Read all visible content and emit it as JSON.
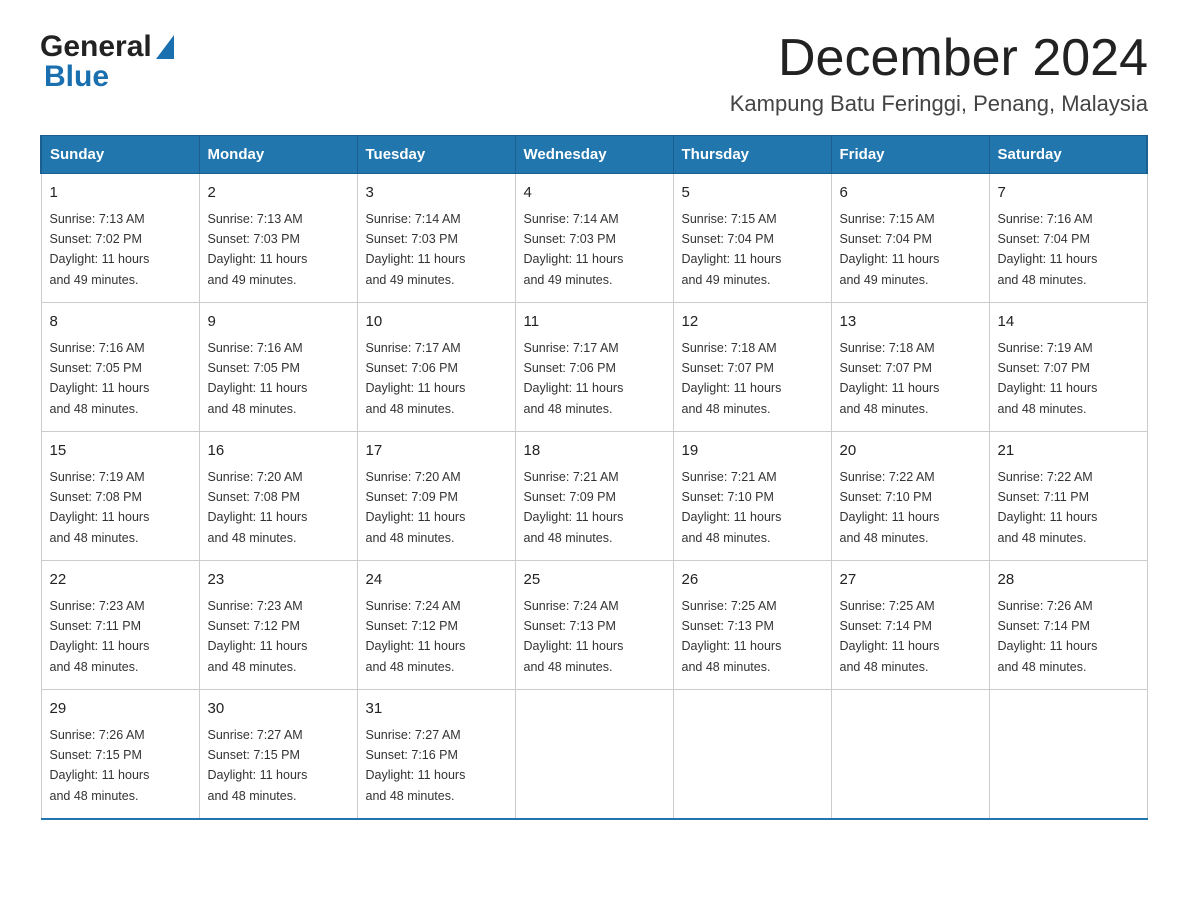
{
  "logo": {
    "text_general": "General",
    "text_blue": "Blue"
  },
  "header": {
    "month_title": "December 2024",
    "location": "Kampung Batu Feringgi, Penang, Malaysia"
  },
  "days_of_week": [
    "Sunday",
    "Monday",
    "Tuesday",
    "Wednesday",
    "Thursday",
    "Friday",
    "Saturday"
  ],
  "weeks": [
    [
      {
        "day": "1",
        "sunrise": "7:13 AM",
        "sunset": "7:02 PM",
        "daylight": "11 hours and 49 minutes."
      },
      {
        "day": "2",
        "sunrise": "7:13 AM",
        "sunset": "7:03 PM",
        "daylight": "11 hours and 49 minutes."
      },
      {
        "day": "3",
        "sunrise": "7:14 AM",
        "sunset": "7:03 PM",
        "daylight": "11 hours and 49 minutes."
      },
      {
        "day": "4",
        "sunrise": "7:14 AM",
        "sunset": "7:03 PM",
        "daylight": "11 hours and 49 minutes."
      },
      {
        "day": "5",
        "sunrise": "7:15 AM",
        "sunset": "7:04 PM",
        "daylight": "11 hours and 49 minutes."
      },
      {
        "day": "6",
        "sunrise": "7:15 AM",
        "sunset": "7:04 PM",
        "daylight": "11 hours and 49 minutes."
      },
      {
        "day": "7",
        "sunrise": "7:16 AM",
        "sunset": "7:04 PM",
        "daylight": "11 hours and 48 minutes."
      }
    ],
    [
      {
        "day": "8",
        "sunrise": "7:16 AM",
        "sunset": "7:05 PM",
        "daylight": "11 hours and 48 minutes."
      },
      {
        "day": "9",
        "sunrise": "7:16 AM",
        "sunset": "7:05 PM",
        "daylight": "11 hours and 48 minutes."
      },
      {
        "day": "10",
        "sunrise": "7:17 AM",
        "sunset": "7:06 PM",
        "daylight": "11 hours and 48 minutes."
      },
      {
        "day": "11",
        "sunrise": "7:17 AM",
        "sunset": "7:06 PM",
        "daylight": "11 hours and 48 minutes."
      },
      {
        "day": "12",
        "sunrise": "7:18 AM",
        "sunset": "7:07 PM",
        "daylight": "11 hours and 48 minutes."
      },
      {
        "day": "13",
        "sunrise": "7:18 AM",
        "sunset": "7:07 PM",
        "daylight": "11 hours and 48 minutes."
      },
      {
        "day": "14",
        "sunrise": "7:19 AM",
        "sunset": "7:07 PM",
        "daylight": "11 hours and 48 minutes."
      }
    ],
    [
      {
        "day": "15",
        "sunrise": "7:19 AM",
        "sunset": "7:08 PM",
        "daylight": "11 hours and 48 minutes."
      },
      {
        "day": "16",
        "sunrise": "7:20 AM",
        "sunset": "7:08 PM",
        "daylight": "11 hours and 48 minutes."
      },
      {
        "day": "17",
        "sunrise": "7:20 AM",
        "sunset": "7:09 PM",
        "daylight": "11 hours and 48 minutes."
      },
      {
        "day": "18",
        "sunrise": "7:21 AM",
        "sunset": "7:09 PM",
        "daylight": "11 hours and 48 minutes."
      },
      {
        "day": "19",
        "sunrise": "7:21 AM",
        "sunset": "7:10 PM",
        "daylight": "11 hours and 48 minutes."
      },
      {
        "day": "20",
        "sunrise": "7:22 AM",
        "sunset": "7:10 PM",
        "daylight": "11 hours and 48 minutes."
      },
      {
        "day": "21",
        "sunrise": "7:22 AM",
        "sunset": "7:11 PM",
        "daylight": "11 hours and 48 minutes."
      }
    ],
    [
      {
        "day": "22",
        "sunrise": "7:23 AM",
        "sunset": "7:11 PM",
        "daylight": "11 hours and 48 minutes."
      },
      {
        "day": "23",
        "sunrise": "7:23 AM",
        "sunset": "7:12 PM",
        "daylight": "11 hours and 48 minutes."
      },
      {
        "day": "24",
        "sunrise": "7:24 AM",
        "sunset": "7:12 PM",
        "daylight": "11 hours and 48 minutes."
      },
      {
        "day": "25",
        "sunrise": "7:24 AM",
        "sunset": "7:13 PM",
        "daylight": "11 hours and 48 minutes."
      },
      {
        "day": "26",
        "sunrise": "7:25 AM",
        "sunset": "7:13 PM",
        "daylight": "11 hours and 48 minutes."
      },
      {
        "day": "27",
        "sunrise": "7:25 AM",
        "sunset": "7:14 PM",
        "daylight": "11 hours and 48 minutes."
      },
      {
        "day": "28",
        "sunrise": "7:26 AM",
        "sunset": "7:14 PM",
        "daylight": "11 hours and 48 minutes."
      }
    ],
    [
      {
        "day": "29",
        "sunrise": "7:26 AM",
        "sunset": "7:15 PM",
        "daylight": "11 hours and 48 minutes."
      },
      {
        "day": "30",
        "sunrise": "7:27 AM",
        "sunset": "7:15 PM",
        "daylight": "11 hours and 48 minutes."
      },
      {
        "day": "31",
        "sunrise": "7:27 AM",
        "sunset": "7:16 PM",
        "daylight": "11 hours and 48 minutes."
      },
      null,
      null,
      null,
      null
    ]
  ],
  "labels": {
    "sunrise": "Sunrise:",
    "sunset": "Sunset:",
    "daylight": "Daylight:"
  }
}
